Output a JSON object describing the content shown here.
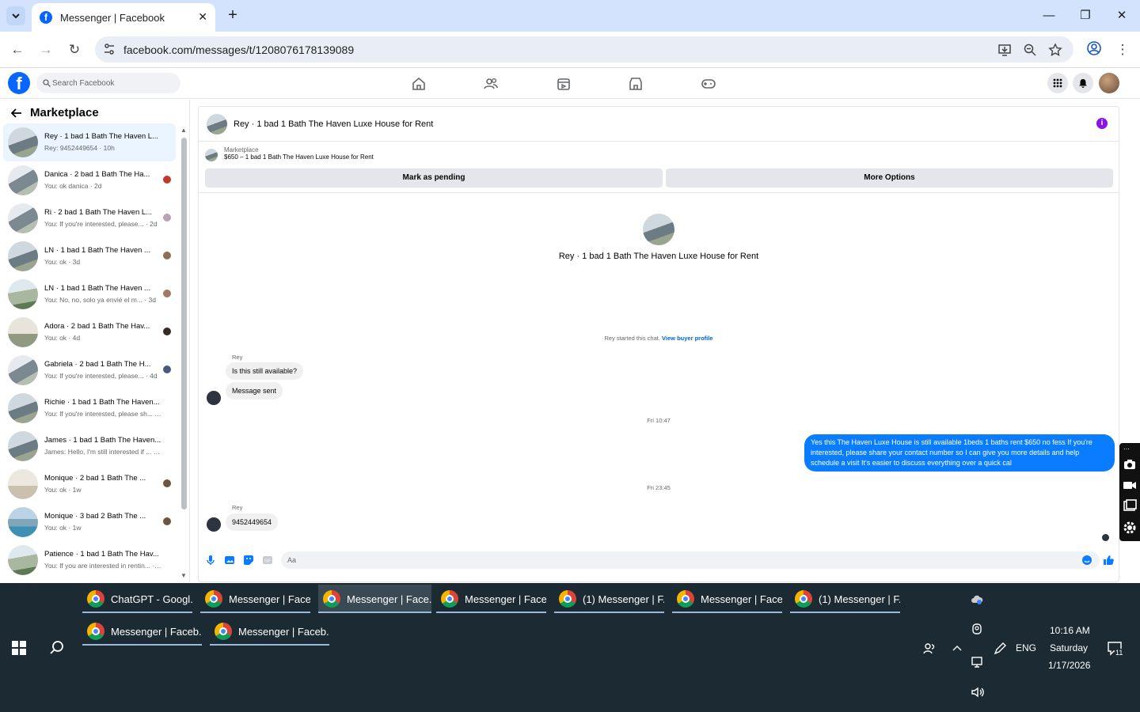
{
  "browser": {
    "tab_title": "Messenger | Facebook",
    "url": "facebook.com/messages/t/1208076178139089"
  },
  "fb": {
    "logo": "f",
    "search_placeholder": "Search Facebook"
  },
  "sidebar": {
    "title": "Marketplace",
    "conversations": [
      {
        "name": "Rey · 1 bad 1 Bath The Haven L...",
        "preview": "Rey: 9452449654 · 10h",
        "active": true
      },
      {
        "name": "Danica · 2 bad 1 Bath The Ha...",
        "preview": "You: ok danica · 2d"
      },
      {
        "name": "Ri · 2 bad 1 Bath The Haven L...",
        "preview": "You: If you're interested, please... · 2d"
      },
      {
        "name": "LN · 1 bad 1 Bath The Haven ...",
        "preview": "You: ok · 3d"
      },
      {
        "name": "LN · 1 bad 1 Bath The Haven ...",
        "preview": "You: No, no, solo ya envié el m... · 3d"
      },
      {
        "name": "Adora · 2 bad 1 Bath The Hav...",
        "preview": "You: ok · 4d"
      },
      {
        "name": "Gabriela · 2 bad 1 Bath The H...",
        "preview": "You: If you're interested, please... · 4d"
      },
      {
        "name": "Richie · 1 bad 1 Bath The Haven...",
        "preview": "You: If you're interested, please sh... · 4d"
      },
      {
        "name": "James · 1 bad 1 Bath The Haven...",
        "preview": "James: Hello, I'm still interested if ... · 1w"
      },
      {
        "name": "Monique · 2 bad 1 Bath The ...",
        "preview": "You: ok · 1w"
      },
      {
        "name": "Monique · 3 bad 2 Bath The ...",
        "preview": "You: ok · 1w"
      },
      {
        "name": "Patience · 1 bad 1 Bath The Hav...",
        "preview": "You: If you are interested in rentin... · 2w"
      }
    ]
  },
  "chat": {
    "header_title": "Rey · 1 bad 1 Bath The Haven Luxe House for Rent",
    "listing_label": "Marketplace",
    "listing_text": "$650 – 1 bad 1 Bath The Haven Luxe House for Rent",
    "btn_pending": "Mark as pending",
    "btn_more": "More Options",
    "profile_name": "Rey · 1 bad 1 Bath The Haven Luxe House for Rent",
    "started_text": "Rey started this chat.",
    "view_profile": "View buyer profile",
    "sender1": "Rey",
    "msg1": "Is this still available?",
    "msg2": "Message sent",
    "time1": "Fri 10:47",
    "reply": "Yes this The Haven Luxe House is still available 1beds 1 baths rent $650 no fess If you're interested, please share your contact number so I can give you more details and help schedule a visit It's easier to discuss everything over a quick cal",
    "time2": "Fri 23:45",
    "sender2": "Rey",
    "msg3": "9452449654",
    "input_placeholder": "Aa"
  },
  "taskbar": {
    "apps": [
      "ChatGPT - Googl...",
      "Messenger | Face...",
      "Messenger | Face...",
      "Messenger | Face...",
      "(1) Messenger | F...",
      "Messenger | Face...",
      "(1) Messenger | F...",
      "Messenger | Faceb...",
      "Messenger | Faceb..."
    ],
    "lang": "ENG",
    "time": "10:16 AM",
    "day": "Saturday",
    "date": "1/17/2026",
    "notif_count": "11"
  },
  "colors": {
    "accent": "#0866ff",
    "bubble_out": "#0a7cff",
    "taskbar": "#1c2b33"
  }
}
